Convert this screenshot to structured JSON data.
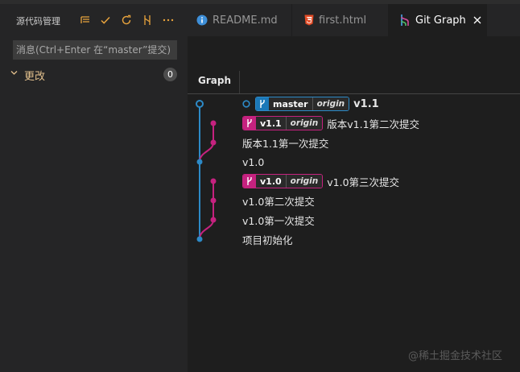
{
  "sidebar": {
    "title": "源代码管理",
    "commit_placeholder": "消息(Ctrl+Enter 在“master”提交)",
    "changes_label": "更改",
    "changes_count": "0"
  },
  "tabs": [
    {
      "label": "README.md",
      "icon": "info-icon",
      "active": false
    },
    {
      "label": "first.html",
      "icon": "html5-icon",
      "active": false
    },
    {
      "label": "Git Graph",
      "icon": "git-graph-icon",
      "active": true
    }
  ],
  "graph": {
    "column_header": "Graph",
    "rows": [
      {
        "refs": [
          {
            "name": "master",
            "remote": "origin"
          }
        ],
        "tag": "v1.1",
        "message": ""
      },
      {
        "refs": [
          {
            "name": "v1.1",
            "remote": "origin"
          }
        ],
        "message": "版本v1.1第二次提交"
      },
      {
        "refs": [],
        "message": "版本1.1第一次提交"
      },
      {
        "refs": [],
        "message": "v1.0"
      },
      {
        "refs": [
          {
            "name": "v1.0",
            "remote": "origin"
          }
        ],
        "message": "v1.0第三次提交"
      },
      {
        "refs": [],
        "message": "v1.0第二次提交"
      },
      {
        "refs": [],
        "message": "v1.0第一次提交"
      },
      {
        "refs": [],
        "message": "项目初始化"
      }
    ]
  },
  "colors": {
    "master_branch": "#2d8ac7",
    "feature_branch": "#c5227f",
    "changes_label": "#e2c08d"
  },
  "watermark": "@稀土掘金技术社区"
}
